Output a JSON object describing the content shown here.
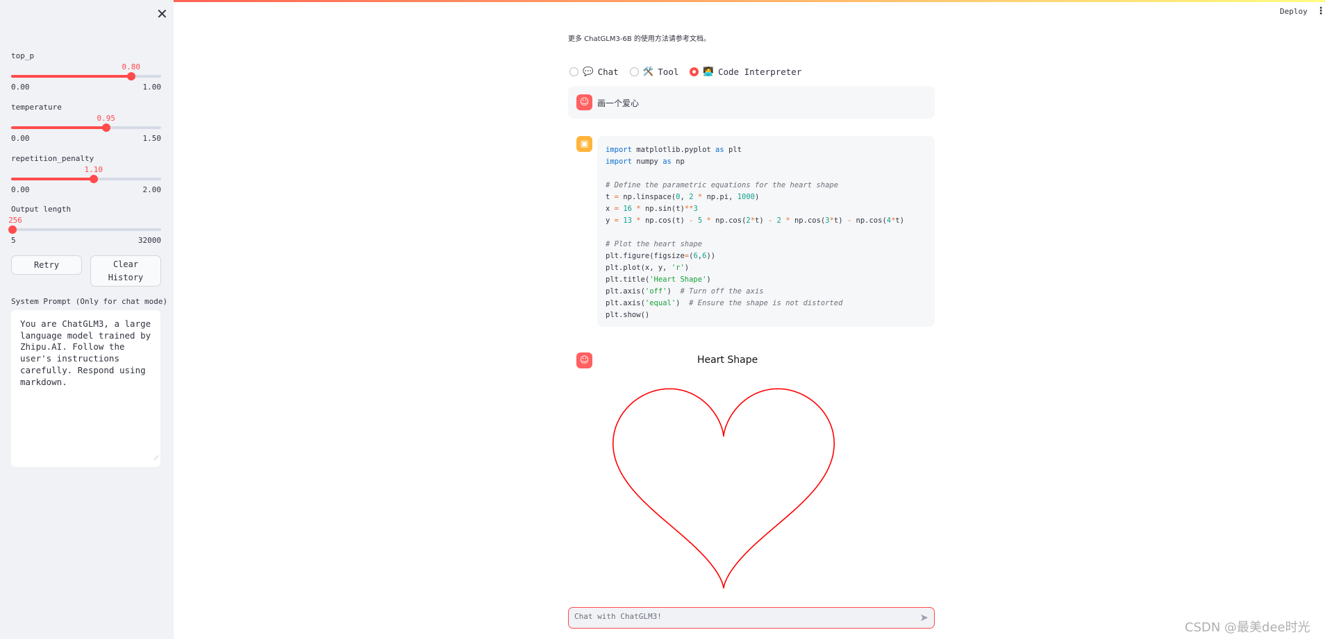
{
  "colors": {
    "accent": "#ff4b4b",
    "user_avatar": "#ff6060",
    "bot_avatar": "#ffb43a"
  },
  "sidebar": {
    "close_icon": "close-icon",
    "sliders": [
      {
        "label": "top_p",
        "value": "0.80",
        "min": "0.00",
        "max": "1.00",
        "fraction": 0.8
      },
      {
        "label": "temperature",
        "value": "0.95",
        "min": "0.00",
        "max": "1.50",
        "fraction": 0.633
      },
      {
        "label": "repetition_penalty",
        "value": "1.10",
        "min": "0.00",
        "max": "2.00",
        "fraction": 0.55
      },
      {
        "label": "Output length",
        "value": "256",
        "min": "5",
        "max": "32000",
        "fraction": 0.0079
      }
    ],
    "retry_label": "Retry",
    "clear_label": "Clear History",
    "system_prompt_label": "System Prompt (Only for chat mode)",
    "system_prompt_value": "You are ChatGLM3, a large language model trained by Zhipu.AI. Follow the user's instructions carefully. Respond using markdown."
  },
  "header": {
    "deploy_label": "Deploy",
    "menu_icon": "kebab-menu-icon"
  },
  "main": {
    "intro": "更多 ChatGLM3-6B 的使用方法请参考文档。",
    "modes": [
      {
        "emoji": "💬",
        "label": "Chat",
        "selected": false
      },
      {
        "emoji": "🛠️",
        "label": "Tool",
        "selected": false
      },
      {
        "emoji": "🧑‍💻",
        "label": "Code Interpreter",
        "selected": true
      }
    ],
    "user_message": "画一个爱心",
    "code_lines": [
      "import matplotlib.pyplot as plt",
      "import numpy as np",
      "",
      "# Define the parametric equations for the heart shape",
      "t = np.linspace(0, 2 * np.pi, 1000)",
      "x = 16 * np.sin(t)**3",
      "y = 13 * np.cos(t) - 5 * np.cos(2*t) - 2 * np.cos(3*t) - np.cos(4*t)",
      "",
      "# Plot the heart shape",
      "plt.figure(figsize=(6,6))",
      "plt.plot(x, y, 'r')",
      "plt.title('Heart Shape')",
      "plt.axis('off')  # Turn off the axis",
      "plt.axis('equal')  # Ensure the shape is not distorted",
      "plt.show()"
    ],
    "plot": {
      "title": "Heart Shape",
      "line_color": "#ff0000"
    },
    "chat_placeholder": "Chat with ChatGLM3!"
  },
  "watermark": "CSDN @最美dee时光"
}
